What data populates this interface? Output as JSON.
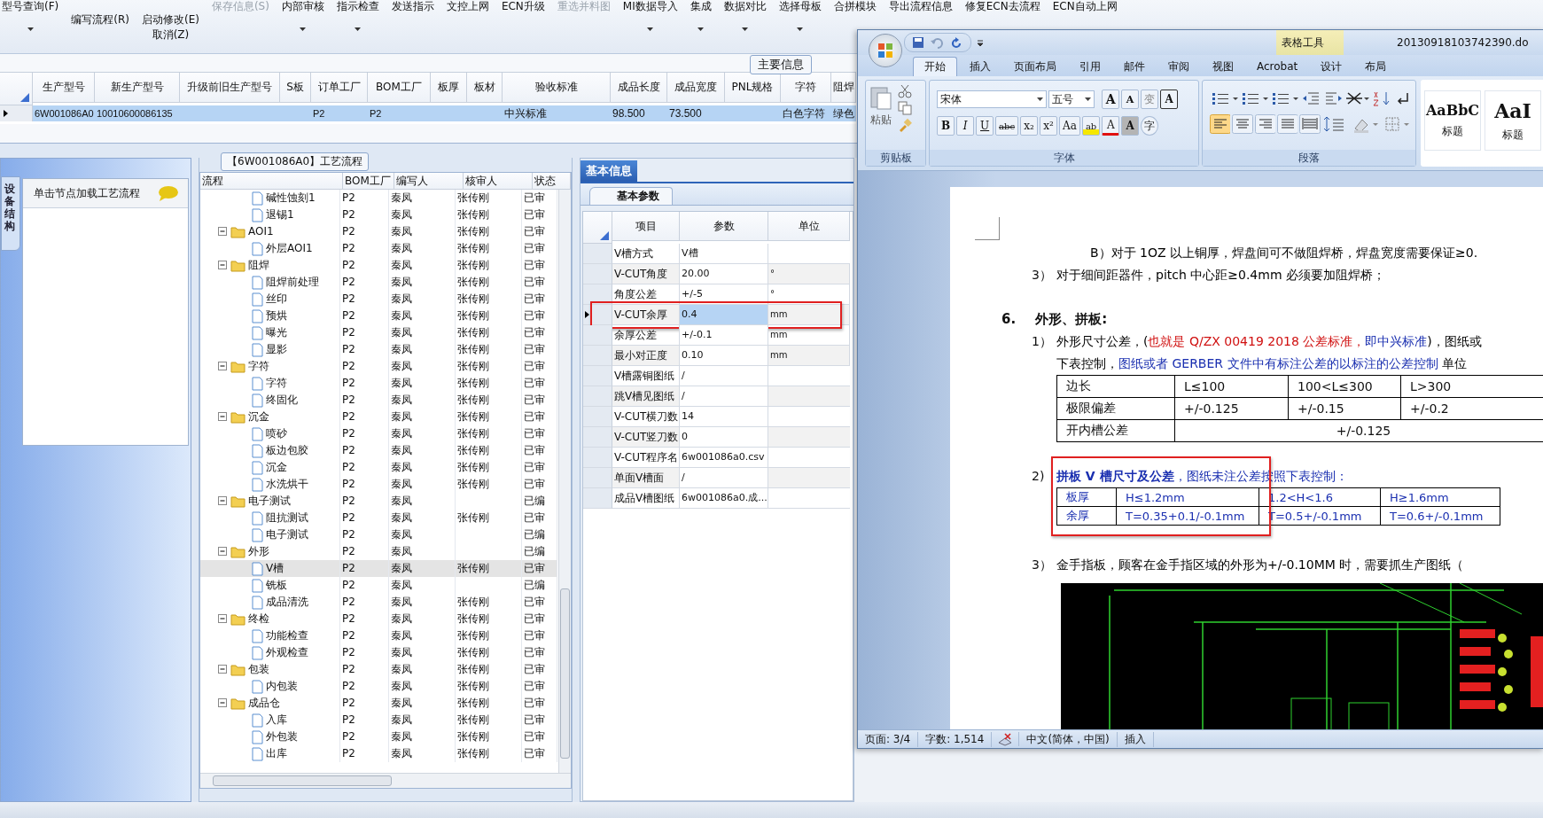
{
  "toolbar": [
    {
      "label": "型号查询(F)",
      "kind": "dropdown",
      "disabled": false
    },
    {
      "label": "编写流程(R)",
      "kind": "lowered",
      "disabled": false
    },
    {
      "label": "启动修改(E)",
      "kind": "stacked",
      "sublabel": "取消(Z)",
      "disabled": false
    },
    {
      "label": "保存信息(S)",
      "kind": "plain",
      "disabled": true
    },
    {
      "label": "内部审核",
      "kind": "dropdown",
      "disabled": false
    },
    {
      "label": "指示检查",
      "kind": "dropdown",
      "disabled": false
    },
    {
      "label": "发送指示",
      "kind": "plain",
      "disabled": false
    },
    {
      "label": "文控上网",
      "kind": "plain",
      "disabled": false
    },
    {
      "label": "ECN升级",
      "kind": "plain",
      "disabled": false
    },
    {
      "label": "重选并料图",
      "kind": "plain",
      "disabled": true
    },
    {
      "label": "MI数据导入",
      "kind": "dropdown",
      "disabled": false
    },
    {
      "label": "集成",
      "kind": "dropdown",
      "disabled": false
    },
    {
      "label": "数据对比",
      "kind": "dropdown",
      "disabled": false
    },
    {
      "label": "选择母板",
      "kind": "dropdown",
      "disabled": false
    },
    {
      "label": "合拼模块",
      "kind": "plain",
      "disabled": false
    },
    {
      "label": "导出流程信息",
      "kind": "plain",
      "disabled": false
    },
    {
      "label": "修复ECN去流程",
      "kind": "plain",
      "disabled": false
    },
    {
      "label": "ECN自动上网",
      "kind": "plain",
      "disabled": false
    }
  ],
  "main_info": {
    "title": "主要信息",
    "columns": [
      "生产型号",
      "新生产型号",
      "升级前旧生产型号",
      "S板",
      "订单工厂",
      "BOM工厂",
      "板厚",
      "板材",
      "验收标准",
      "成品长度",
      "成品宽度",
      "PNL规格",
      "字符",
      "阻焊"
    ],
    "rows": [
      {
        "selected": true,
        "cells": [
          "6W001086A0",
          "10010600086135",
          null,
          null,
          "P2",
          "P2",
          null,
          null,
          "中兴标准",
          "98.500",
          "73.500",
          null,
          "白色字符",
          "绿色"
        ]
      }
    ]
  },
  "side_panel": {
    "tab": "设备结构",
    "hint": "单击节点加载工艺流程"
  },
  "process_flow": {
    "title": "【6W001086A0】工艺流程",
    "columns": [
      "流程",
      "BOM工厂",
      "编写人",
      "核审人",
      "状态"
    ],
    "tree": [
      {
        "children": [
          {
            "label": "碱性蚀刻1",
            "kind": "step",
            "bom": "P2",
            "writer": "秦凤",
            "reviewer": "张传刚",
            "status": "已审",
            "selected": false
          },
          {
            "label": "退锡1",
            "kind": "step",
            "bom": "P2",
            "writer": "秦凤",
            "reviewer": "张传刚",
            "status": "已审",
            "selected": false
          }
        ]
      },
      {
        "label": "AOI1",
        "kind": "folder",
        "expanded": true,
        "bom": "P2",
        "writer": "秦凤",
        "reviewer": "张传刚",
        "status": "已审",
        "selected": false,
        "children": [
          {
            "label": "外层AOI1",
            "kind": "step",
            "bom": "P2",
            "writer": "秦凤",
            "reviewer": "张传刚",
            "status": "已审",
            "selected": false
          }
        ]
      },
      {
        "label": "阻焊",
        "kind": "folder",
        "expanded": true,
        "bom": "P2",
        "writer": "秦凤",
        "reviewer": "张传刚",
        "status": "已审",
        "selected": false,
        "children": [
          {
            "label": "阻焊前处理",
            "kind": "step",
            "bom": "P2",
            "writer": "秦凤",
            "reviewer": "张传刚",
            "status": "已审",
            "selected": false
          },
          {
            "label": "丝印",
            "kind": "step",
            "bom": "P2",
            "writer": "秦凤",
            "reviewer": "张传刚",
            "status": "已审",
            "selected": false
          },
          {
            "label": "预烘",
            "kind": "step",
            "bom": "P2",
            "writer": "秦凤",
            "reviewer": "张传刚",
            "status": "已审",
            "selected": false
          },
          {
            "label": "曝光",
            "kind": "step",
            "bom": "P2",
            "writer": "秦凤",
            "reviewer": "张传刚",
            "status": "已审",
            "selected": false
          },
          {
            "label": "显影",
            "kind": "step",
            "bom": "P2",
            "writer": "秦凤",
            "reviewer": "张传刚",
            "status": "已审",
            "selected": false
          }
        ]
      },
      {
        "label": "字符",
        "kind": "folder",
        "expanded": true,
        "bom": "P2",
        "writer": "秦凤",
        "reviewer": "张传刚",
        "status": "已审",
        "selected": false,
        "children": [
          {
            "label": "字符",
            "kind": "step",
            "bom": "P2",
            "writer": "秦凤",
            "reviewer": "张传刚",
            "status": "已审",
            "selected": false
          },
          {
            "label": "终固化",
            "kind": "step",
            "bom": "P2",
            "writer": "秦凤",
            "reviewer": "张传刚",
            "status": "已审",
            "selected": false
          }
        ]
      },
      {
        "label": "沉金",
        "kind": "folder",
        "expanded": true,
        "bom": "P2",
        "writer": "秦凤",
        "reviewer": "张传刚",
        "status": "已审",
        "selected": false,
        "children": [
          {
            "label": "喷砂",
            "kind": "step",
            "bom": "P2",
            "writer": "秦凤",
            "reviewer": "张传刚",
            "status": "已审",
            "selected": false
          },
          {
            "label": "板边包胶",
            "kind": "step",
            "bom": "P2",
            "writer": "秦凤",
            "reviewer": "张传刚",
            "status": "已审",
            "selected": false
          },
          {
            "label": "沉金",
            "kind": "step",
            "bom": "P2",
            "writer": "秦凤",
            "reviewer": "张传刚",
            "status": "已审",
            "selected": false
          },
          {
            "label": "水洗烘干",
            "kind": "step",
            "bom": "P2",
            "writer": "秦凤",
            "reviewer": "张传刚",
            "status": "已审",
            "selected": false
          }
        ]
      },
      {
        "label": "电子测试",
        "kind": "folder",
        "expanded": true,
        "bom": "P2",
        "writer": "秦凤",
        "status": "已编",
        "selected": false,
        "children": [
          {
            "label": "阻抗测试",
            "kind": "step",
            "bom": "P2",
            "writer": "秦凤",
            "reviewer": "张传刚",
            "status": "已审",
            "selected": false
          },
          {
            "label": "电子测试",
            "kind": "step",
            "bom": "P2",
            "writer": "秦凤",
            "status": "已编",
            "selected": false
          }
        ]
      },
      {
        "label": "外形",
        "kind": "folder",
        "expanded": true,
        "bom": "P2",
        "writer": "秦凤",
        "status": "已编",
        "selected": false,
        "children": [
          {
            "label": "V槽",
            "kind": "step",
            "bom": "P2",
            "writer": "秦凤",
            "reviewer": "张传刚",
            "status": "已审",
            "selected": true
          },
          {
            "label": "铣板",
            "kind": "step",
            "bom": "P2",
            "writer": "秦凤",
            "status": "已编",
            "selected": false
          },
          {
            "label": "成品清洗",
            "kind": "step",
            "bom": "P2",
            "writer": "秦凤",
            "reviewer": "张传刚",
            "status": "已审",
            "selected": false
          }
        ]
      },
      {
        "label": "终检",
        "kind": "folder",
        "expanded": true,
        "bom": "P2",
        "writer": "秦凤",
        "reviewer": "张传刚",
        "status": "已审",
        "selected": false,
        "children": [
          {
            "label": "功能检查",
            "kind": "step",
            "bom": "P2",
            "writer": "秦凤",
            "reviewer": "张传刚",
            "status": "已审",
            "selected": false
          },
          {
            "label": "外观检查",
            "kind": "step",
            "bom": "P2",
            "writer": "秦凤",
            "reviewer": "张传刚",
            "status": "已审",
            "selected": false
          }
        ]
      },
      {
        "label": "包装",
        "kind": "folder",
        "expanded": true,
        "bom": "P2",
        "writer": "秦凤",
        "reviewer": "张传刚",
        "status": "已审",
        "selected": false,
        "children": [
          {
            "label": "内包装",
            "kind": "step",
            "bom": "P2",
            "writer": "秦凤",
            "reviewer": "张传刚",
            "status": "已审",
            "selected": false
          }
        ]
      },
      {
        "label": "成品仓",
        "kind": "folder",
        "expanded": true,
        "bom": "P2",
        "writer": "秦凤",
        "reviewer": "张传刚",
        "status": "已审",
        "selected": false,
        "children": [
          {
            "label": "入库",
            "kind": "step",
            "bom": "P2",
            "writer": "秦凤",
            "reviewer": "张传刚",
            "status": "已审",
            "selected": false
          },
          {
            "label": "外包装",
            "kind": "step",
            "bom": "P2",
            "writer": "秦凤",
            "reviewer": "张传刚",
            "status": "已审",
            "selected": false
          },
          {
            "label": "出库",
            "kind": "step",
            "bom": "P2",
            "writer": "秦凤",
            "reviewer": "张传刚",
            "status": "已审",
            "selected": false
          }
        ]
      }
    ]
  },
  "basic_info": {
    "tab": "基本信息",
    "subtab": "基本参数",
    "columns": [
      "项目",
      "参数",
      "单位"
    ],
    "rows": [
      {
        "item": "V槽方式",
        "value": "V槽",
        "selected": false,
        "annotated": false
      },
      {
        "item": "V-CUT角度",
        "value": "20.00",
        "unit": "°",
        "selected": false,
        "annotated": false
      },
      {
        "item": "角度公差",
        "value": "+/-5",
        "unit": "°",
        "selected": false,
        "annotated": false
      },
      {
        "item": "V-CUT余厚",
        "value": "0.4",
        "unit": "mm",
        "selected": true,
        "annotated": true
      },
      {
        "item": "余厚公差",
        "value": "+/-0.1",
        "unit": "mm",
        "selected": false,
        "annotated": false
      },
      {
        "item": "最小对正度",
        "value": "0.10",
        "unit": "mm",
        "selected": false,
        "annotated": false
      },
      {
        "item": "V槽露铜图纸",
        "value": "/",
        "selected": false,
        "annotated": false
      },
      {
        "item": "跳V槽见图纸",
        "value": "/",
        "selected": false,
        "annotated": false
      },
      {
        "item": "V-CUT横刀数",
        "value": "14",
        "selected": false,
        "annotated": false
      },
      {
        "item": "V-CUT竖刀数",
        "value": "0",
        "selected": false,
        "annotated": false
      },
      {
        "item": "V-CUT程序名",
        "value": "6w001086a0.csv",
        "selected": false,
        "annotated": false
      },
      {
        "item": "单面V槽面",
        "value": "/",
        "selected": false,
        "annotated": false
      },
      {
        "item": "成品V槽图纸",
        "value": "6w001086a0.成...",
        "selected": false,
        "annotated": false
      }
    ]
  },
  "word": {
    "context_tab": "表格工具",
    "title": "20130918103742390.do",
    "tabs": [
      {
        "label": "开始",
        "selected": true
      },
      {
        "label": "插入",
        "selected": false
      },
      {
        "label": "页面布局",
        "selected": false
      },
      {
        "label": "引用",
        "selected": false
      },
      {
        "label": "邮件",
        "selected": false
      },
      {
        "label": "审阅",
        "selected": false
      },
      {
        "label": "视图",
        "selected": false
      },
      {
        "label": "Acrobat",
        "selected": false
      },
      {
        "label": "设计",
        "selected": false
      },
      {
        "label": "布局",
        "selected": false
      }
    ],
    "clipboard": {
      "paste": "粘贴",
      "label": "剪贴板"
    },
    "font": {
      "name": "宋体",
      "size": "五号",
      "label": "字体",
      "row1": [
        {
          "label": "A",
          "kind": "grow"
        },
        {
          "label": "A",
          "kind": "shrink"
        },
        {
          "label": "变",
          "kind": "phonetic"
        },
        {
          "label": "A",
          "kind": "boxed"
        }
      ],
      "row2": [
        {
          "label": "B",
          "kind": "bold"
        },
        {
          "label": "I",
          "kind": "italic"
        },
        {
          "label": "U",
          "kind": "underline"
        },
        {
          "label": "abc",
          "kind": "strike"
        },
        {
          "label": "x₂",
          "kind": "sub"
        },
        {
          "label": "x²",
          "kind": "sup"
        },
        {
          "label": "Aa",
          "kind": "case"
        },
        {
          "label": "ab",
          "kind": "highlight"
        },
        {
          "label": "A",
          "kind": "color"
        },
        {
          "label": "A",
          "kind": "shade"
        },
        {
          "label": "字",
          "kind": "enclose"
        }
      ]
    },
    "paragraph": {
      "label": "段落",
      "align": [
        {
          "kind": "left",
          "selected": true
        },
        {
          "kind": "center",
          "selected": false
        },
        {
          "kind": "right",
          "selected": false
        },
        {
          "kind": "justify",
          "selected": false
        },
        {
          "kind": "distributed",
          "selected": false
        }
      ]
    },
    "styles": [
      {
        "sample": "AaBbC",
        "name": "标题"
      },
      {
        "sample": "AaI",
        "name": "标题"
      }
    ],
    "document": [
      {
        "kind": "subitem",
        "segments": [
          {
            "text": "B）对于 1OZ 以上铜厚，焊盘间可不做阻焊桥，焊盘宽度需要保证≥0."
          }
        ]
      },
      {
        "kind": "item",
        "number": "3）",
        "lines": [
          [
            {
              "text": "对于细间距器件，pitch 中心距≥0.4mm 必须要加阻焊桥；"
            }
          ]
        ]
      },
      {
        "kind": "heading",
        "number": "6.",
        "text": "外形、拼板:"
      },
      {
        "kind": "item",
        "number": "1）",
        "lines": [
          [
            {
              "text": "外形尺寸公差，("
            },
            {
              "text": "也就是 Q/ZX 00419 2018 公差标准，",
              "color": "#d01010"
            },
            {
              "text": "即中兴标准",
              "color": "#1a2fb0"
            },
            {
              "text": ")，图纸或"
            }
          ],
          [
            {
              "text": "下表控制，"
            },
            {
              "text": "图纸或者 GERBER 文件中有标注公差的以标注的公差控制",
              "color": "#1a2fb0"
            },
            {
              "text": "  单位"
            }
          ]
        ]
      },
      {
        "kind": "table",
        "rows": [
          [
            "边长",
            "L≤100",
            "100<L≤300",
            "L>300"
          ],
          [
            "极限偏差",
            "+/-0.125",
            "+/-0.15",
            "+/-0.2"
          ],
          [
            "开内槽公差",
            {
              "text": "+/-0.125",
              "colspan": 3
            }
          ]
        ]
      },
      {
        "kind": "section",
        "annotated": true,
        "number": "2)",
        "segments": [
          {
            "text": "拼板 V 槽尺寸及公差",
            "color": "#1a2fb0",
            "bold": true
          },
          {
            "text": "，图纸未注公差按照下表控制：",
            "color": "#1a2fb0"
          }
        ],
        "rows": [
          [
            "板厚",
            "H≤1.2mm",
            "1.2<H<1.6",
            "H≥1.6mm"
          ],
          [
            "余厚",
            "T=0.35+0.1/-0.1mm",
            "T=0.5+/-0.1mm",
            "T=0.6+/-0.1mm"
          ]
        ]
      },
      {
        "kind": "item",
        "number": "3）",
        "lines": [
          [
            {
              "text": "金手指板，顾客在金手指区域的外形为+/-0.10MM 时，需要抓生产图纸（"
            }
          ]
        ]
      },
      {
        "kind": "figure"
      }
    ],
    "status": [
      {
        "label": "页面: 3/4",
        "kind": "text"
      },
      {
        "label": "字数: 1,514",
        "kind": "text"
      },
      {
        "kind": "proofing"
      },
      {
        "label": "中文(简体，中国)",
        "kind": "text"
      },
      {
        "label": "插入",
        "kind": "text"
      }
    ]
  }
}
